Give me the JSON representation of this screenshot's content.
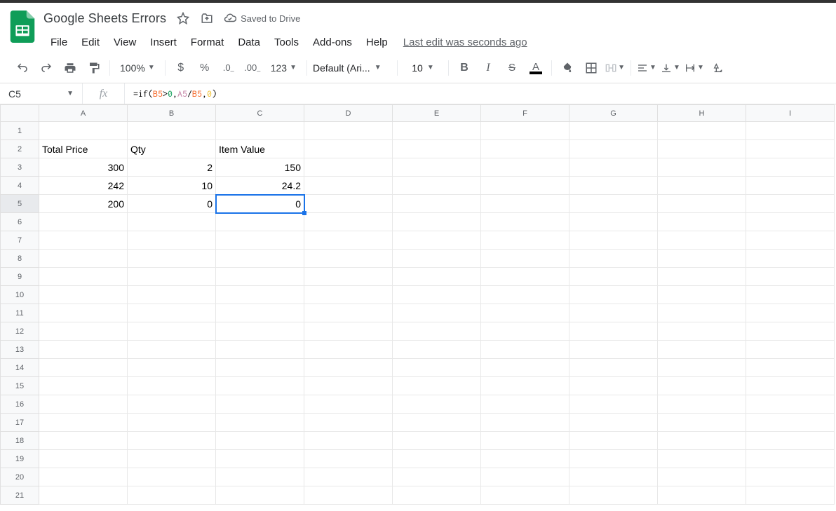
{
  "doc_title": "Google Sheets Errors",
  "saved_text": "Saved to Drive",
  "menubar": [
    "File",
    "Edit",
    "View",
    "Insert",
    "Format",
    "Data",
    "Tools",
    "Add-ons",
    "Help"
  ],
  "last_edit": "Last edit was seconds ago",
  "toolbar": {
    "zoom": "100%",
    "number_format": "123",
    "font_name": "Default (Ari...",
    "font_size": "10"
  },
  "namebox": "C5",
  "formula": {
    "raw": "=if(B5>0,A5/B5,0)",
    "parts": [
      {
        "text": "=if(",
        "cls": "fn"
      },
      {
        "text": "B5",
        "cls": "ref1"
      },
      {
        "text": ">",
        "cls": "fn"
      },
      {
        "text": "0",
        "cls": "num"
      },
      {
        "text": ",",
        "cls": "fn"
      },
      {
        "text": "A5",
        "cls": "ref2"
      },
      {
        "text": "/",
        "cls": "fn"
      },
      {
        "text": "B5",
        "cls": "ref1"
      },
      {
        "text": ",",
        "cls": "fn"
      },
      {
        "text": "0",
        "cls": "ref3"
      },
      {
        "text": ")",
        "cls": "fn"
      }
    ]
  },
  "columns": [
    "A",
    "B",
    "C",
    "D",
    "E",
    "F",
    "G",
    "H",
    "I"
  ],
  "row_count": 21,
  "selected": {
    "row": 5,
    "col": "C"
  },
  "cells": {
    "A2": {
      "v": "Total Price",
      "align": "l"
    },
    "B2": {
      "v": "Qty",
      "align": "l"
    },
    "C2": {
      "v": "Item Value",
      "align": "l"
    },
    "A3": {
      "v": "300",
      "align": "r"
    },
    "B3": {
      "v": "2",
      "align": "r"
    },
    "C3": {
      "v": "150",
      "align": "r"
    },
    "A4": {
      "v": "242",
      "align": "r"
    },
    "B4": {
      "v": "10",
      "align": "r"
    },
    "C4": {
      "v": "24.2",
      "align": "r"
    },
    "A5": {
      "v": "200",
      "align": "r"
    },
    "B5": {
      "v": "0",
      "align": "r"
    },
    "C5": {
      "v": "0",
      "align": "r"
    }
  }
}
